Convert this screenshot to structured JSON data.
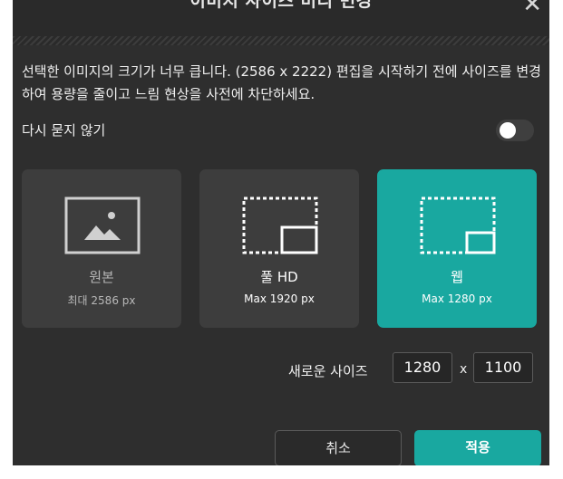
{
  "dialog": {
    "title": "이미지 사이즈 미리 변경",
    "message": "선택한 이미지의 크기가 너무 큽니다. (2586 x 2222) 편집을 시작하기 전에 사이즈를 변경하여 용량을 줄이고 느림 현상을 사전에 차단하세요.",
    "dont_ask_label": "다시 묻지 않기",
    "dont_ask_enabled": false
  },
  "options": [
    {
      "name": "원본",
      "sub": "최대 2586 px",
      "icon": "image-icon",
      "selected": false
    },
    {
      "name": "풀 HD",
      "sub": "Max 1920 px",
      "icon": "resize-icon",
      "selected": false
    },
    {
      "name": "웹",
      "sub": "Max 1280 px",
      "icon": "resize-icon",
      "selected": true
    }
  ],
  "new_size": {
    "label": "새로운 사이즈",
    "width": "1280",
    "separator": "x",
    "height": "1100"
  },
  "buttons": {
    "cancel": "취소",
    "apply": "적용"
  },
  "colors": {
    "accent": "#19a8a0",
    "dialog_bg": "#2e2e2e",
    "card_bg": "#3d3d3d"
  }
}
